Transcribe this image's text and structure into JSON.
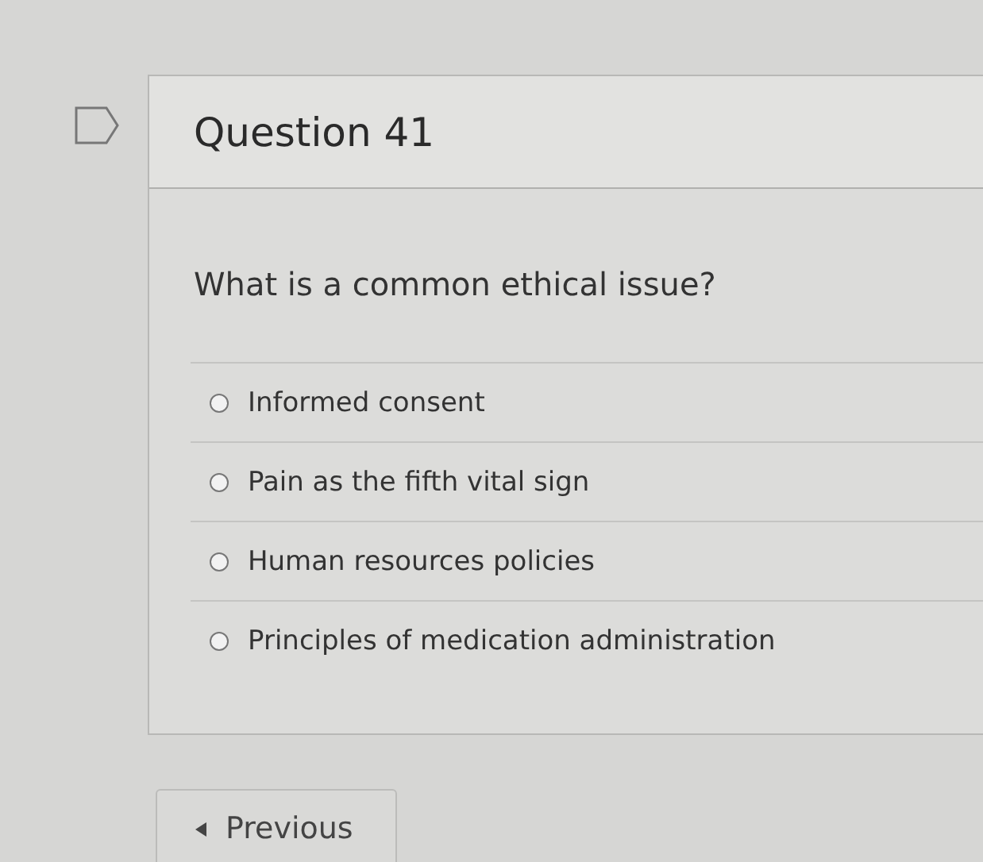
{
  "question": {
    "title": "Question 41",
    "flagged": false,
    "prompt": "What is a common ethical issue?",
    "options": [
      {
        "label": "Informed consent",
        "selected": false
      },
      {
        "label": "Pain as the fifth vital sign",
        "selected": false
      },
      {
        "label": "Human resources policies",
        "selected": false
      },
      {
        "label": "Principles of medication administration",
        "selected": false
      }
    ]
  },
  "navigation": {
    "previous": "Previous"
  }
}
